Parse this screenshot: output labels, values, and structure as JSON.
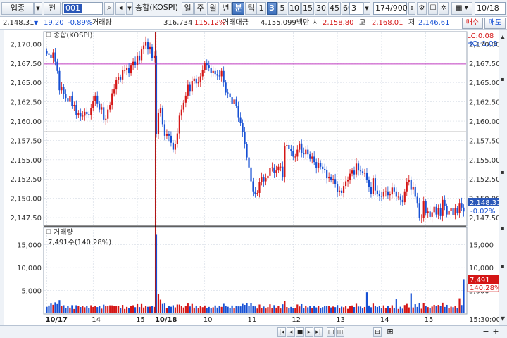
{
  "toolbar": {
    "market_select": "업종",
    "market_select_arrow": "▼",
    "period_select": "전",
    "code_input": "001",
    "name_field": "종합(KOSPI)",
    "period_tabs": [
      "일",
      "주",
      "월",
      "년",
      "분",
      "틱"
    ],
    "active_period_tab": "분",
    "minute_options": [
      "1",
      "3",
      "5",
      "10",
      "15",
      "30",
      "45",
      "60"
    ],
    "active_minute": "3",
    "custom_interval": "3",
    "data_count": "174/900",
    "date_field": "10/18"
  },
  "info_bar": {
    "current": "2,148.31",
    "direction": "▼",
    "change": "19.20",
    "change_rate": "-0.89%",
    "volume_label": "거래량",
    "volume": "316,734",
    "volume_ratio": "115.12%",
    "amount_label": "거래대금",
    "amount": "4,155,099백만",
    "open_label": "시",
    "open": "2,158.80",
    "high_label": "고",
    "high": "2,168.01",
    "low_label": "저",
    "low": "2,146.61",
    "buy_button": "매수",
    "sell_button": "매도"
  },
  "chart_labels": {
    "price_title": "종합(KOSPI)",
    "lc_label": "LC:0.08",
    "hc_label": "HC:-1.03",
    "volume_title": "거래량",
    "volume_subtitle": "7,491주(140.28%)",
    "current_price_tag": "2,148.31",
    "current_change_tag": "-0.02%",
    "current_volume_tag": "7,491",
    "current_volume_rate_tag": "140.28%",
    "time_axis_end": "15:30:00"
  },
  "colors": {
    "up": "#d41616",
    "down": "#1650d4",
    "magenta_line": "#c03cc0",
    "level_line": "#000000",
    "day_divider": "#b01010",
    "grid": "#d3dae4"
  },
  "icons": [
    "search-icon",
    "speaker-icon",
    "calendar-icon",
    "settings-icon",
    "checkbox-icon",
    "zoom-in-icon",
    "zoom-out-icon"
  ],
  "chart_data": [
    {
      "type": "candlestick",
      "title": "종합(KOSPI)",
      "ylim": [
        2146.5,
        2171.5
      ],
      "y_ticks": [
        "2,147.50",
        "2,150.00",
        "2,152.50",
        "2,155.00",
        "2,157.50",
        "2,160.00",
        "2,162.50",
        "2,165.00",
        "2,167.50",
        "2,170.00"
      ],
      "y_tick_values": [
        2147.5,
        2150,
        2152.5,
        2155,
        2157.5,
        2160,
        2162.5,
        2165,
        2167.5,
        2170
      ],
      "x_labels": [
        "10/17",
        "14",
        "15",
        "10/18",
        "10",
        "11",
        "12",
        "13",
        "14",
        "15"
      ],
      "x_label_index": [
        0,
        22,
        43,
        52,
        75,
        96,
        117,
        138,
        159,
        180
      ],
      "day_divider_index": 51,
      "horizontal_levels": [
        2167.4,
        2158.6,
        2146.4
      ],
      "close_series": [
        2168.8,
        2168.6,
        2168.2,
        2168.9,
        2167.7,
        2166.5,
        2164.0,
        2164.4,
        2163.5,
        2163.0,
        2162.5,
        2163.2,
        2162.0,
        2162.1,
        2160.8,
        2161.1,
        2160.6,
        2160.7,
        2161.2,
        2160.9,
        2160.8,
        2161.7,
        2162.6,
        2163.3,
        2162.3,
        2161.5,
        2161.8,
        2160.2,
        2160.3,
        2161.5,
        2162.1,
        2163.6,
        2164.1,
        2165.3,
        2165.7,
        2165.4,
        2166.6,
        2166.6,
        2166.9,
        2166.2,
        2167.2,
        2167.7,
        2167.3,
        2168.5,
        2167.9,
        2169.3,
        2169.8,
        2170.3,
        2169.3,
        2169.6,
        2168.2,
        2168.5,
        2158.3,
        2161.1,
        2161.7,
        2159.6,
        2158.1,
        2158.3,
        2158.1,
        2157.2,
        2156.3,
        2157.0,
        2158.4,
        2160.7,
        2161.5,
        2162.4,
        2163.3,
        2164.7,
        2163.9,
        2165.2,
        2165.5,
        2164.9,
        2165.1,
        2165.8,
        2166.6,
        2167.5,
        2167.2,
        2166.9,
        2166.3,
        2166.5,
        2166.1,
        2165.9,
        2165.8,
        2166.5,
        2165.0,
        2163.7,
        2163.6,
        2163.1,
        2162.2,
        2162.8,
        2162.0,
        2160.5,
        2159.8,
        2158.6,
        2157.0,
        2155.3,
        2154.0,
        2152.2,
        2150.9,
        2150.6,
        2150.7,
        2152.1,
        2152.7,
        2152.2,
        2152.6,
        2152.9,
        2153.9,
        2154.0,
        2153.3,
        2153.6,
        2154.1,
        2154.1,
        2152.7,
        2156.8,
        2156.9,
        2156.4,
        2156.1,
        2155.4,
        2155.4,
        2156.3,
        2157.1,
        2155.9,
        2155.7,
        2156.3,
        2155.7,
        2155.1,
        2155.4,
        2154.7,
        2153.9,
        2154.6,
        2154.1,
        2153.8,
        2153.7,
        2152.6,
        2152.8,
        2152.4,
        2152.5,
        2151.8,
        2150.8,
        2151.0,
        2150.7,
        2151.6,
        2152.2,
        2152.4,
        2153.2,
        2153.6,
        2153.1,
        2154.5,
        2153.6,
        2153.5,
        2153.3,
        2153.3,
        2152.4,
        2151.5,
        2150.6,
        2152.6,
        2151.0,
        2150.6,
        2150.3,
        2150.2,
        2150.8,
        2150.9,
        2150.4,
        2150.5,
        2151.4,
        2150.9,
        2150.2,
        2150.2,
        2149.8,
        2149.5,
        2150.9,
        2152.1,
        2152.4,
        2151.1,
        2151.5,
        2150.2,
        2149.4,
        2147.5,
        2147.5,
        2149.6,
        2148.1,
        2148.3,
        2147.6,
        2148.2,
        2148.9,
        2147.9,
        2148.7,
        2147.7,
        2149.8,
        2149.0,
        2147.9,
        2148.4,
        2148.7,
        2147.8,
        2148.7,
        2148.1,
        2149.4,
        2148.8,
        2148.3
      ]
    },
    {
      "type": "bar",
      "title": "거래량",
      "ylim": [
        0,
        18500
      ],
      "y_ticks": [
        "5,000",
        "10,000",
        "15,000"
      ],
      "y_tick_values": [
        5000,
        10000,
        15000
      ],
      "spike_index": 52,
      "spike_value": 17200,
      "last_value": 7491
    }
  ]
}
